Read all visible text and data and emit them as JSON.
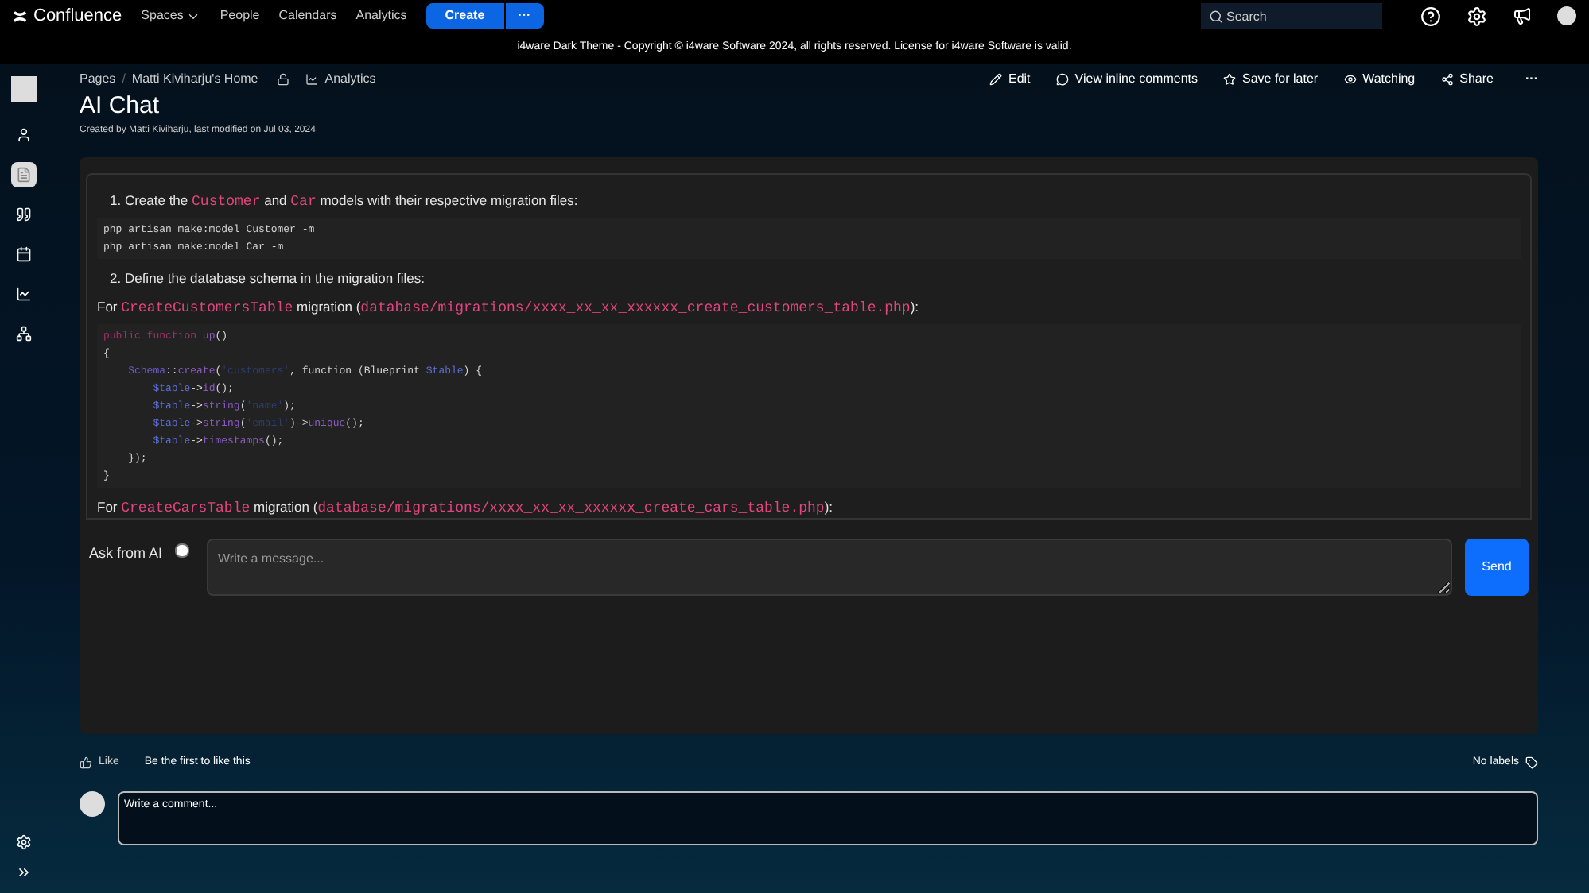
{
  "topnav": {
    "logo": "Confluence",
    "links": [
      {
        "label": "Spaces",
        "dropdown": true
      },
      {
        "label": "People",
        "dropdown": false
      },
      {
        "label": "Calendars",
        "dropdown": false
      },
      {
        "label": "Analytics",
        "dropdown": false
      }
    ],
    "create": "Create",
    "more": "···",
    "search": {
      "placeholder": "Search"
    }
  },
  "banner": "i4ware Dark Theme - Copyright © i4ware Software 2024, all rights reserved. License for i4ware Software is valid.",
  "breadcrumbs": [
    "Pages",
    "Matti Kiviharju's Home"
  ],
  "breadcrumb_separator": "/",
  "analytics": "Analytics",
  "actions": [
    {
      "kind": "edit",
      "label": "Edit"
    },
    {
      "kind": "comment",
      "label": "View inline comments"
    },
    {
      "kind": "star",
      "label": "Save for later"
    },
    {
      "kind": "eye",
      "label": "Watching"
    },
    {
      "kind": "share",
      "label": "Share"
    }
  ],
  "more_actions": "···",
  "title": "AI Chat",
  "byline": "Created by Matti Kiviharju, last modified on Jul 03, 2024",
  "sidebar": {
    "items": [
      {
        "kind": "person",
        "selected": false
      },
      {
        "kind": "page",
        "selected": true
      },
      {
        "kind": "quote",
        "selected": false
      },
      {
        "kind": "calendar",
        "selected": false
      },
      {
        "kind": "chart",
        "selected": false
      },
      {
        "kind": "tree",
        "selected": false
      }
    ]
  },
  "chat": {
    "blocks": [
      {
        "kind": "step",
        "segments": [
          {
            "kind": "text",
            "text": "1. Create the "
          },
          {
            "kind": "code",
            "text": "Customer"
          },
          {
            "kind": "text",
            "text": " and "
          },
          {
            "kind": "code",
            "text": "Car"
          },
          {
            "kind": "text",
            "text": " models with their respective migration files:"
          }
        ]
      },
      {
        "kind": "code",
        "lines": [
          [
            {
              "kind": "plain",
              "text": "php artisan make:model Customer -m"
            }
          ],
          [
            {
              "kind": "plain",
              "text": "php artisan make:model Car -m"
            }
          ]
        ]
      },
      {
        "kind": "step",
        "segments": [
          {
            "kind": "text",
            "text": "2. Define the database schema in the migration files:"
          }
        ]
      },
      {
        "kind": "para",
        "segments": [
          {
            "kind": "text",
            "text": "For "
          },
          {
            "kind": "code",
            "text": "CreateCustomersTable"
          },
          {
            "kind": "text",
            "text": " migration ("
          },
          {
            "kind": "code",
            "text": "database/migrations/xxxx_xx_xx_xxxxxx_create_customers_table.php"
          },
          {
            "kind": "text",
            "text": "):"
          }
        ]
      },
      {
        "kind": "code",
        "lines": [
          [
            {
              "kind": "keyword",
              "text": "public function "
            },
            {
              "kind": "fn",
              "text": "up"
            },
            {
              "kind": "plain",
              "text": "()"
            }
          ],
          [
            {
              "kind": "plain",
              "text": "{"
            }
          ],
          [
            {
              "kind": "class",
              "text": "    Schema"
            },
            {
              "kind": "plain",
              "text": "::"
            },
            {
              "kind": "fn",
              "text": "create"
            },
            {
              "kind": "plain",
              "text": "("
            },
            {
              "kind": "string",
              "text": "'customers'"
            },
            {
              "kind": "plain",
              "text": ", function (Blueprint "
            },
            {
              "kind": "var",
              "text": "$table"
            },
            {
              "kind": "plain",
              "text": ") {"
            }
          ],
          [
            {
              "kind": "var",
              "text": "        $table"
            },
            {
              "kind": "plain",
              "text": "->"
            },
            {
              "kind": "fn",
              "text": "id"
            },
            {
              "kind": "plain",
              "text": "();"
            }
          ],
          [
            {
              "kind": "var",
              "text": "        $table"
            },
            {
              "kind": "plain",
              "text": "->"
            },
            {
              "kind": "fn",
              "text": "string"
            },
            {
              "kind": "plain",
              "text": "("
            },
            {
              "kind": "string",
              "text": "'name'"
            },
            {
              "kind": "plain",
              "text": ");"
            }
          ],
          [
            {
              "kind": "var",
              "text": "        $table"
            },
            {
              "kind": "plain",
              "text": "->"
            },
            {
              "kind": "fn",
              "text": "string"
            },
            {
              "kind": "plain",
              "text": "("
            },
            {
              "kind": "string",
              "text": "'email'"
            },
            {
              "kind": "plain",
              "text": ")->"
            },
            {
              "kind": "fn",
              "text": "unique"
            },
            {
              "kind": "plain",
              "text": "();"
            }
          ],
          [
            {
              "kind": "var",
              "text": "        $table"
            },
            {
              "kind": "plain",
              "text": "->"
            },
            {
              "kind": "fn",
              "text": "timestamps"
            },
            {
              "kind": "plain",
              "text": "();"
            }
          ],
          [
            {
              "kind": "plain",
              "text": "    });"
            }
          ],
          [
            {
              "kind": "plain",
              "text": "}"
            }
          ]
        ]
      },
      {
        "kind": "para",
        "segments": [
          {
            "kind": "text",
            "text": "For "
          },
          {
            "kind": "code",
            "text": "CreateCarsTable"
          },
          {
            "kind": "text",
            "text": " migration ("
          },
          {
            "kind": "code",
            "text": "database/migrations/xxxx_xx_xx_xxxxxx_create_cars_table.php"
          },
          {
            "kind": "text",
            "text": "):"
          }
        ]
      }
    ],
    "ask_label": "Ask from AI",
    "ask_checked": false,
    "message": {
      "placeholder": "Write a message..."
    },
    "send": "Send"
  },
  "like": "Like",
  "like_note": "Be the first to like this",
  "labels": "No labels",
  "comment": {
    "placeholder": "Write a comment..."
  }
}
